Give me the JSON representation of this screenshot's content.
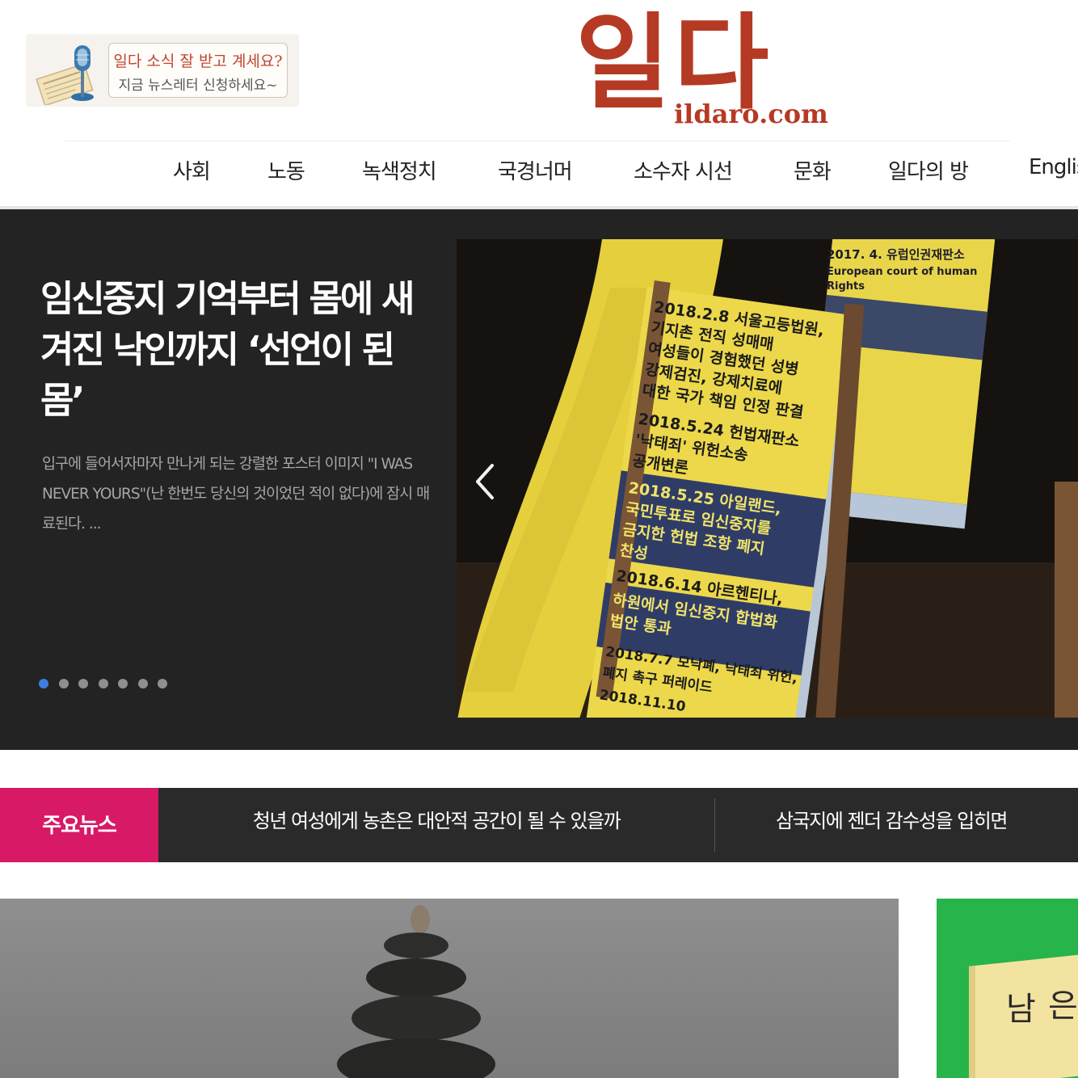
{
  "header": {
    "newsletter": {
      "line1": "일다 소식 잘 받고 계세요?",
      "line2": "지금 뉴스레터 신청하세요~"
    },
    "logo": {
      "main": "일다",
      "domain": "ildaro.com",
      "color": "#b53a24"
    }
  },
  "nav": {
    "items": [
      "사회",
      "노동",
      "녹색정치",
      "국경너머",
      "소수자 시선",
      "문화",
      "일다의 방",
      "English"
    ]
  },
  "hero": {
    "title": "임신중지 기억부터 몸에 새겨진 낙인까지 ‘선언이 된 몸’",
    "summary": "입구에 들어서자마자 만나게 되는 강렬한 포스터 이미지 \"I WAS NEVER YOURS\"(난 한번도 당신의 것이었던 적이 없다)에 잠시 매료된다. ...",
    "slide_count": 7,
    "active_slide": 1,
    "active_dot_color": "#3b7de0",
    "image_texts": {
      "t1": "2018.2.8 서울고등법원,",
      "t2": "기지촌 전직 성매매",
      "t3": "여성들이 경험했던 성병",
      "t4": "강제검진, 강제치료에",
      "t5": "대한 국가 책임 인정 판결",
      "t6": "2018.5.24 헌법재판소",
      "t7": "'낙태죄' 위헌소송",
      "t8": "공개변론",
      "t9": "2018.5.25 아일랜드,",
      "t10": "국민투표로 임신중지를",
      "t11": "금지한 헌법 조항 폐지",
      "t12": "찬성",
      "t13": "2018.6.14 아르헨티나,",
      "t14": "하원에서 임신중지 합법화",
      "t15": "법안 통과",
      "t16": "2018.7.7 모낙폐, 낙태죄 위헌,",
      "t17": "폐지 촉구 퍼레이드",
      "t18": "2017. 4. 유럽인권재판소",
      "t19": "European court of human",
      "t20": "Rights",
      "t21": "2018.11.10"
    }
  },
  "main_news": {
    "label": "주요뉴스",
    "label_color": "#d81a66",
    "headlines": [
      "청년 여성에게 농촌은 대안적 공간이 될 수 있을까",
      "삼국지에 젠더 감수성을 입히면"
    ]
  },
  "ad": {
    "book_char1": "남",
    "book_char2": "은",
    "panel_color": "#27b44a"
  }
}
